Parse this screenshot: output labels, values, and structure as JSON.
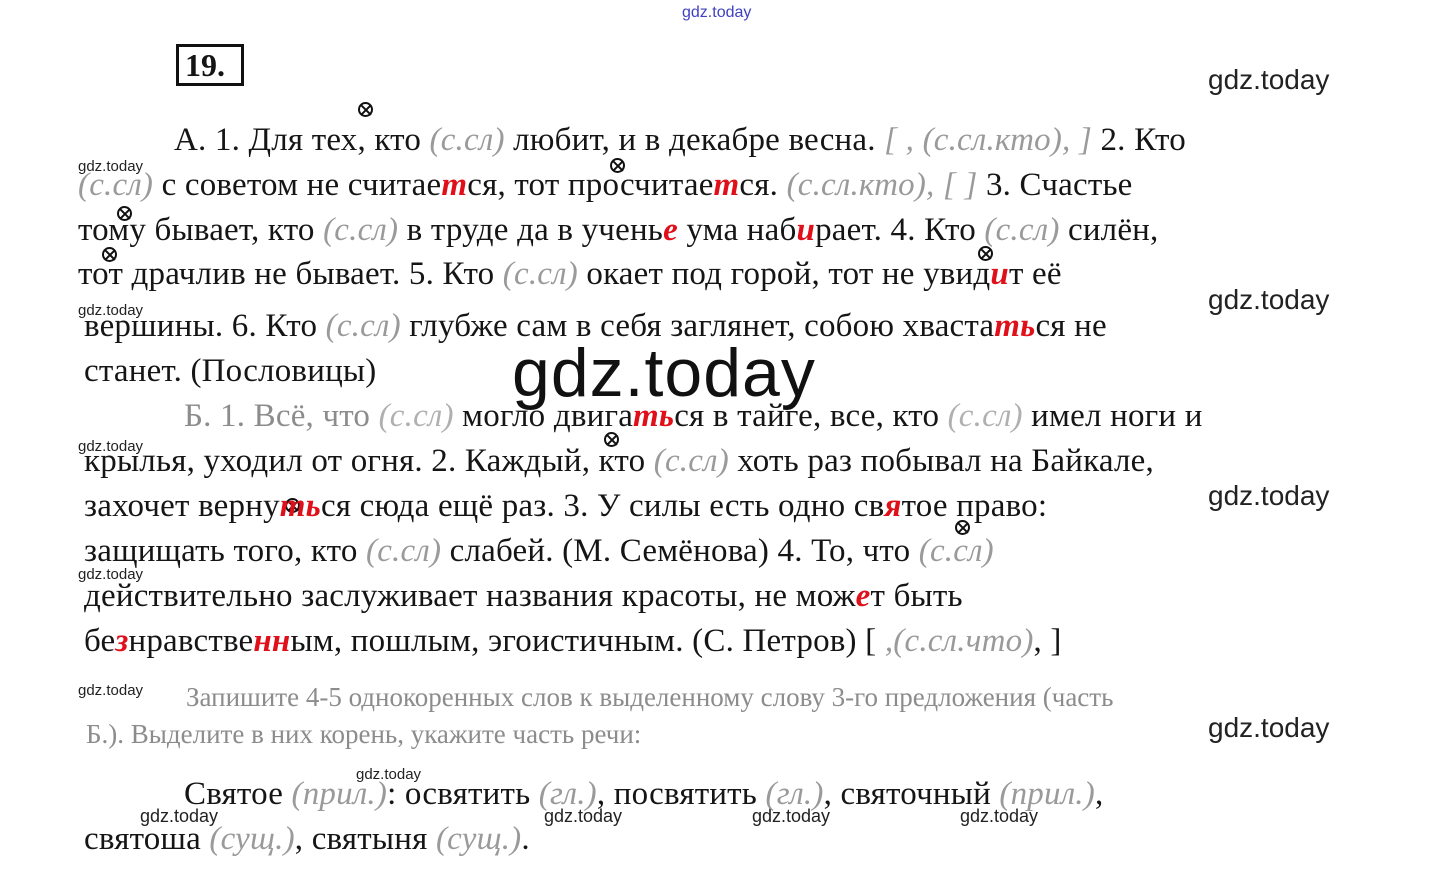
{
  "watermarks": {
    "site": "gdz.today"
  },
  "task": {
    "number": "19"
  },
  "lineA1": {
    "s1": "А. 1. Для тех, кто ",
    "g1": "(с.сл)",
    "s2": " любит, и в декабре весна. ",
    "g2": "[ , (с.сл.кто), ]",
    "s3": " 2. Кто"
  },
  "lineA2": {
    "g1": "(с.сл)",
    "s1": " с советом не считае",
    "r1": "т",
    "s2": "ся, тот просчитае",
    "r2": "т",
    "s3": "ся. ",
    "g2": "(с.сл.кто), [ ]",
    "s4": " 3. Счастье"
  },
  "lineA3": {
    "s1": "тому бывает, кто ",
    "g1": "(с.сл)",
    "s2": " в труде да в учень",
    "r1": "е",
    "s3": " ума наб",
    "r2": "и",
    "s4": "рает. 4. Кто ",
    "g2": "(с.сл)",
    "s5": " силён,"
  },
  "lineA4": {
    "s1": "тот драчлив не бывает. 5. Кто ",
    "g1": "(с.сл)",
    "s2": " окает под горой, тот не увид",
    "r1": "и",
    "s3": "т её"
  },
  "lineA5": {
    "s1": "вершины. 6. Кто ",
    "g1": "(с.сл)",
    "s2": " глубже сам в себя заглянет, собою хваста",
    "r1": "ть",
    "s3": "ся не"
  },
  "lineA6": {
    "s1": "станет. (Пословицы)"
  },
  "lineB1": {
    "s1": "Б. 1. Всё, что ",
    "g1": "(с.сл)",
    "s2": " могло двига",
    "r1": "ть",
    "s3": "ся в тайге, все, кто ",
    "g2": "(с.сл)",
    "s4": " имел ноги и"
  },
  "lineB2": {
    "s1": "крылья, уходил от огня. 2. Каждый, кто ",
    "g1": "(с.сл)",
    "s2": " хоть раз побывал на Байкале,"
  },
  "lineB3": {
    "s1": "захочет верну",
    "r1": "ть",
    "s2": "ся сюда ещё раз. 3. У силы есть одно св",
    "r2": "я",
    "s3": "тое право:"
  },
  "lineB4": {
    "s1": "защищать того, кто ",
    "g1": "(с.сл)",
    "s2": " слабей. (М. Семёнова) 4. То, что ",
    "g2": "(с.сл)"
  },
  "lineB5": {
    "s1": "действительно заслуживает названия красоты, не мож",
    "r1": "е",
    "s2": "т быть"
  },
  "lineB6": {
    "s1": "бе",
    "r1": "з",
    "s2": "нравстве",
    "r2": "нн",
    "s3": "ым, пошлым, эгоистичным. (С. Петров) [ ",
    "g1": ",(с.сл.что)",
    "s4": ", ]"
  },
  "instruction": {
    "line1": "Запишите 4-5 однокоренных слов к выделенному слову 3-го предложения (часть",
    "line2": "Б.). Выделите в них корень, укажите часть речи:"
  },
  "answer1": {
    "s1": "Святое ",
    "g1": "(прил.)",
    "s2": ": освятить ",
    "g2": "(гл.)",
    "s3": ", посвятить ",
    "g3": "(гл.)",
    "s4": ", святочный ",
    "g4": "(прил.)",
    "s5": ","
  },
  "answer2": {
    "s1": "святоша ",
    "g1": "(сущ.)",
    "s2": ", святыня ",
    "g2": "(сущ.)",
    "s3": "."
  }
}
